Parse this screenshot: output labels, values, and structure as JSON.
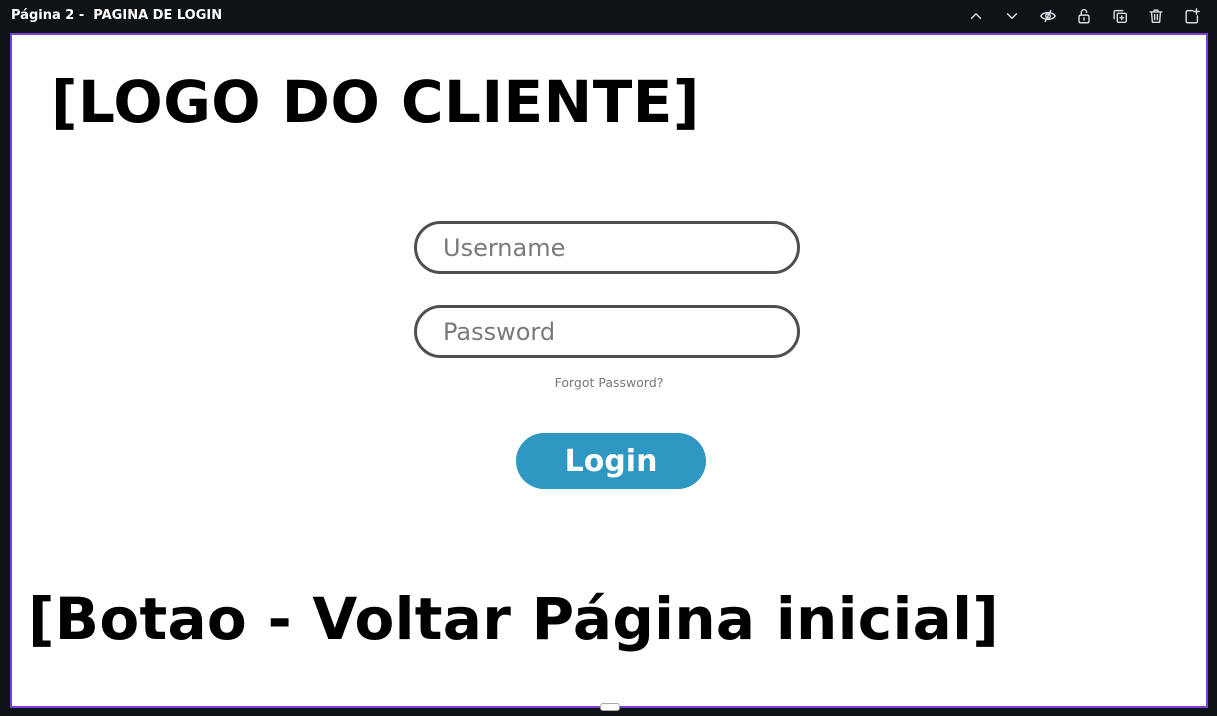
{
  "topbar": {
    "page_label": "Página 2 -  PAGINA DE LOGIN",
    "icons": [
      "chevron-up-icon",
      "chevron-down-icon",
      "eye-hidden-icon",
      "lock-open-icon",
      "duplicate-icon",
      "trash-icon",
      "add-page-icon"
    ]
  },
  "canvas": {
    "logo_placeholder": "[LOGO DO CLIENTE]",
    "username_placeholder": "Username",
    "password_placeholder": "Password",
    "forgot_password": "Forgot Password?",
    "login_label": "Login",
    "back_button_placeholder": "[Botao - Voltar Página inicial]"
  },
  "colors": {
    "topbar_bg": "#0e1318",
    "canvas_border": "#7b3fd6",
    "login_button": "#2f98c2"
  }
}
